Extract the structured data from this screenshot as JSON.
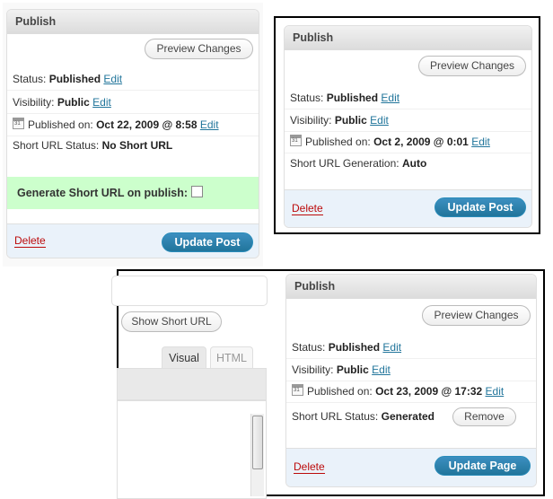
{
  "panel1": {
    "title": "Publish",
    "preview_label": "Preview Changes",
    "status_label": "Status:",
    "status_value": "Published",
    "visibility_label": "Visibility:",
    "visibility_value": "Public",
    "published_label": "Published on:",
    "published_value": "Oct 22, 2009 @ 8:58",
    "short_url_label": "Short URL Status:",
    "short_url_value": "No Short URL",
    "generate_label": "Generate Short URL on publish:",
    "edit_label": "Edit",
    "delete_label": "Delete",
    "update_label": "Update Post"
  },
  "panel2": {
    "title": "Publish",
    "preview_label": "Preview Changes",
    "status_label": "Status:",
    "status_value": "Published",
    "visibility_label": "Visibility:",
    "visibility_value": "Public",
    "published_label": "Published on:",
    "published_value": "Oct 2, 2009 @ 0:01",
    "short_url_label": "Short URL Generation:",
    "short_url_value": "Auto",
    "edit_label": "Edit",
    "delete_label": "Delete",
    "update_label": "Update Post"
  },
  "panel3": {
    "show_short_url_label": "Show Short URL",
    "tab_visual": "Visual",
    "tab_html": "HTML",
    "title": "Publish",
    "preview_label": "Preview Changes",
    "status_label": "Status:",
    "status_value": "Published",
    "visibility_label": "Visibility:",
    "visibility_value": "Public",
    "published_label": "Published on:",
    "published_value": "Oct 23, 2009 @ 17:32",
    "short_url_label": "Short URL Status:",
    "short_url_value": "Generated",
    "remove_label": "Remove",
    "edit_label": "Edit",
    "delete_label": "Delete",
    "update_label": "Update Page"
  },
  "colors": {
    "link": "#21759b",
    "delete": "#bc0b0b",
    "primary_button": "#21759b",
    "highlight_green": "#ccffcc",
    "footer_blue": "#eaf2fa"
  }
}
